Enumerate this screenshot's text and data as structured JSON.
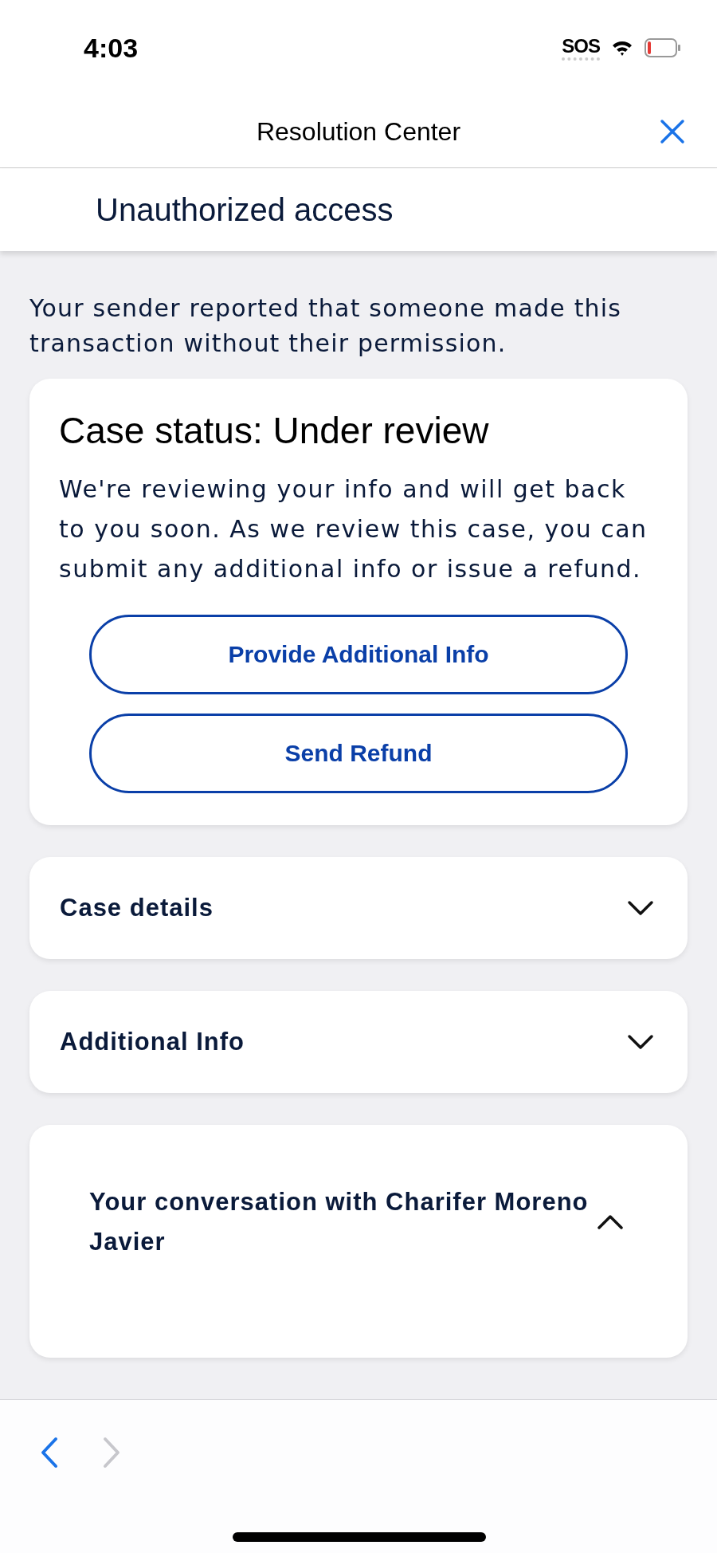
{
  "status_bar": {
    "time": "4:03",
    "sos": "SOS"
  },
  "header": {
    "title": "Resolution Center"
  },
  "subheader": {
    "title": "Unauthorized access"
  },
  "intro": "Your sender reported that someone made this transaction without their permission.",
  "status_card": {
    "title": "Case status: Under review",
    "body": "We're reviewing your info and will get back to you soon. As we review this case, you can submit any additional info or issue a refund.",
    "buttons": [
      "Provide Additional Info",
      "Send Refund"
    ]
  },
  "sections": [
    {
      "title": "Case details",
      "expanded": false
    },
    {
      "title": "Additional Info",
      "expanded": false
    },
    {
      "title": "Your conversation with Charifer Moreno Javier",
      "expanded": true
    }
  ],
  "toolbar": {
    "back_disabled": false,
    "forward_disabled": true
  }
}
